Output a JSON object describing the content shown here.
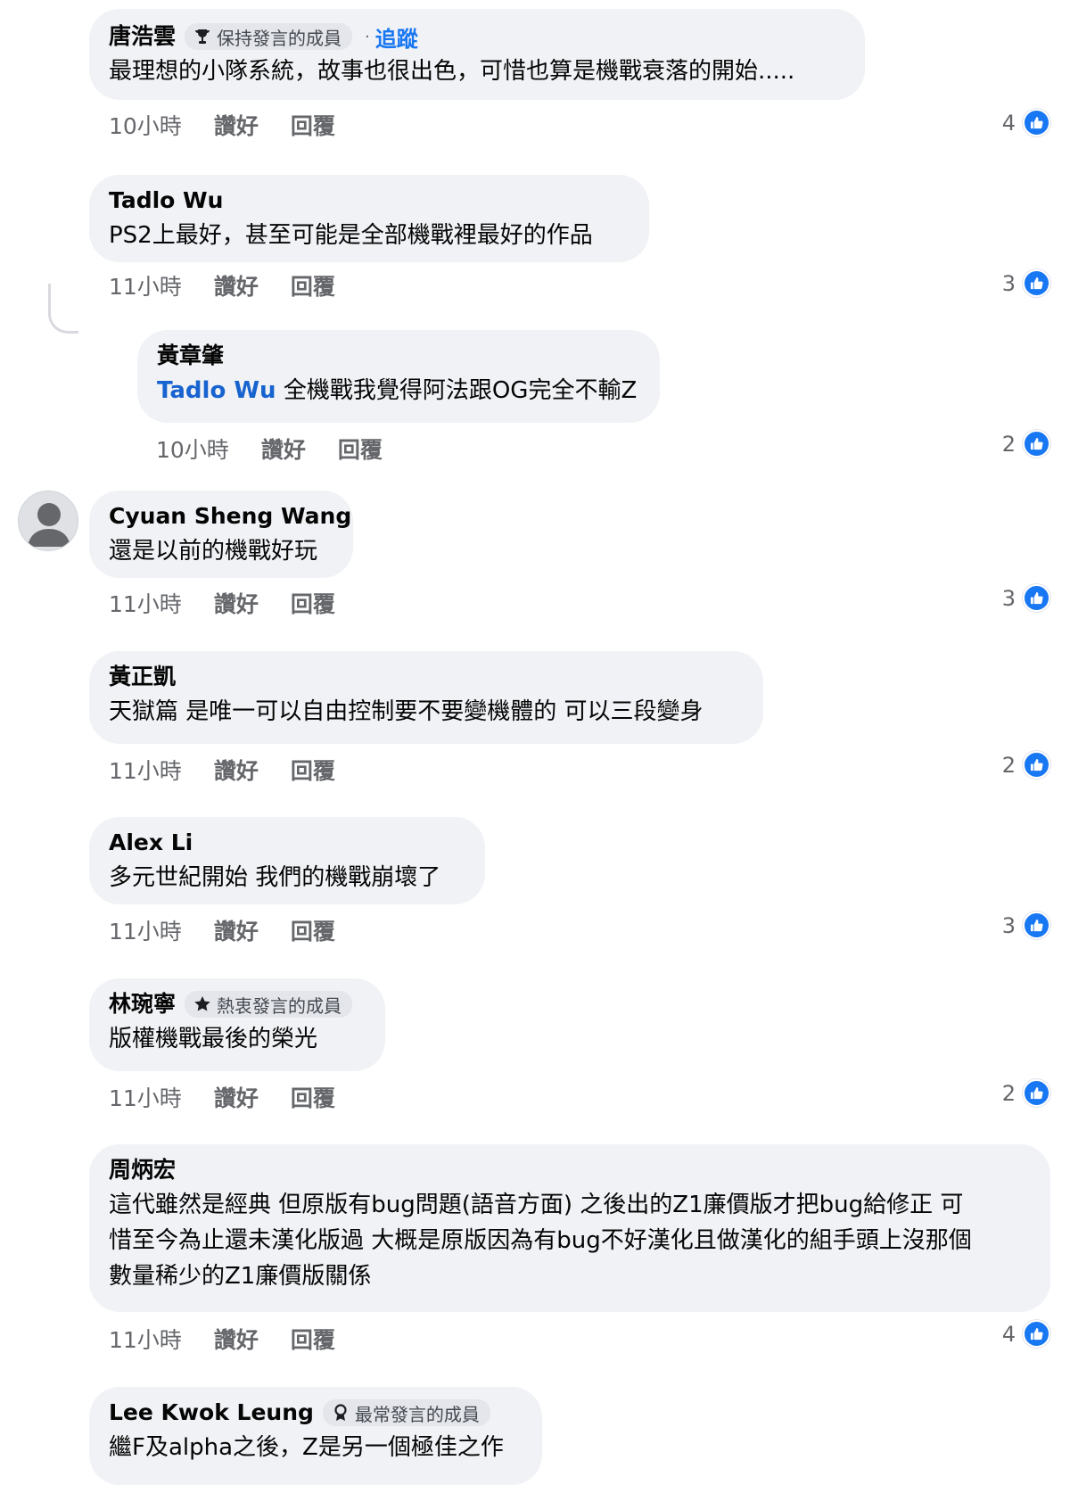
{
  "comments": [
    {
      "author": "唐浩雲",
      "badge": "保持發言的成員",
      "follow": "追蹤",
      "text": "最理想的小隊系統，故事也很出色，可惜也算是機戰衰落的開始.....",
      "time": "10小時",
      "like": "讚好",
      "reply": "回覆",
      "likes": "4"
    },
    {
      "author": "Tadlo Wu",
      "text": "PS2上最好，甚至可能是全部機戰裡最好的作品",
      "time": "11小時",
      "like": "讚好",
      "reply": "回覆",
      "likes": "3"
    },
    {
      "author": "黃章肇",
      "mention": "Tadlo Wu",
      "text": " 全機戰我覺得阿法跟OG完全不輸Z",
      "time": "10小時",
      "like": "讚好",
      "reply": "回覆",
      "likes": "2"
    },
    {
      "author": "Cyuan Sheng Wang",
      "text": "還是以前的機戰好玩",
      "time": "11小時",
      "like": "讚好",
      "reply": "回覆",
      "likes": "3"
    },
    {
      "author": "黃正凱",
      "text": "天獄篇 是唯一可以自由控制要不要變機體的 可以三段變身",
      "time": "11小時",
      "like": "讚好",
      "reply": "回覆",
      "likes": "2"
    },
    {
      "author": "Alex Li",
      "text": "多元世紀開始 我們的機戰崩壞了",
      "time": "11小時",
      "like": "讚好",
      "reply": "回覆",
      "likes": "3"
    },
    {
      "author": "林琬寧",
      "badge": "熱衷發言的成員",
      "text": "版權機戰最後的榮光",
      "time": "11小時",
      "like": "讚好",
      "reply": "回覆",
      "likes": "2"
    },
    {
      "author": "周炳宏",
      "text_lines": [
        "這代雖然是經典 但原版有bug問題(語音方面) 之後出的Z1廉價版才把bug給修正 可",
        "惜至今為止還未漢化版過 大概是原版因為有bug不好漢化且做漢化的組手頭上沒那個",
        "數量稀少的Z1廉價版關係"
      ],
      "time": "11小時",
      "like": "讚好",
      "reply": "回覆",
      "likes": "4"
    },
    {
      "author": "Lee Kwok Leung",
      "badge": "最常發言的成員",
      "text": "繼F及alpha之後，Z是另一個極佳之作"
    }
  ],
  "icons": {
    "like": "thumbs-up-icon",
    "avatar": "default-avatar-icon",
    "badge_1": "trophy-icon",
    "badge_2": "star-icon",
    "badge_3": "ribbon-icon"
  },
  "colors": {
    "bubble": "#f0f2f5",
    "link": "#1877f2",
    "meta": "#65676b"
  }
}
